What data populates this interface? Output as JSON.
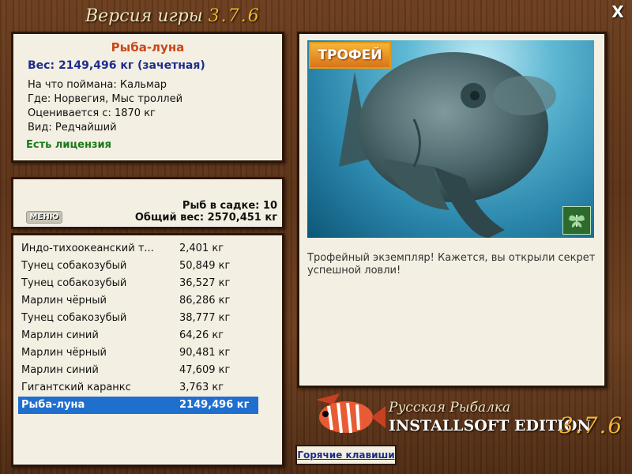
{
  "header": {
    "title": "Версия игры",
    "version": "3.7.6",
    "close_glyph": "X"
  },
  "info": {
    "fish_name": "Рыба-луна",
    "weight": "Вес: 2149,496 кг (зачетная)",
    "bait": "На что поймана: Кальмар",
    "location": "Где: Норвегия, Мыс троллей",
    "valued": "Оценивается с: 1870 кг",
    "rarity": "Вид: Редчайший",
    "license": "Есть лицензия"
  },
  "stats": {
    "menu_label": "МЕНЮ",
    "fish_count": "Рыб в садке: 10",
    "total_weight": "Общий вес: 2570,451 кг"
  },
  "catch_list": [
    {
      "name": "Индо-тихоокеанский т...",
      "weight": "2,401 кг"
    },
    {
      "name": "Тунец собакозубый",
      "weight": "50,849 кг"
    },
    {
      "name": "Тунец собакозубый",
      "weight": "36,527 кг"
    },
    {
      "name": "Марлин чёрный",
      "weight": "86,286 кг"
    },
    {
      "name": "Тунец собакозубый",
      "weight": "38,777 кг"
    },
    {
      "name": "Марлин синий",
      "weight": "64,26 кг"
    },
    {
      "name": "Марлин чёрный",
      "weight": "90,481 кг"
    },
    {
      "name": "Марлин синий",
      "weight": "47,609 кг"
    },
    {
      "name": "Гигантский каранкс",
      "weight": "3,763 кг"
    },
    {
      "name": "Рыба-луна",
      "weight": "2149,496 кг"
    }
  ],
  "selected_index": 9,
  "detail": {
    "badge": "ТРОФЕЙ",
    "description": "Трофейный экземпляр! Кажется, вы открыли секрет успешной ловли!",
    "icon": "butterfly-icon"
  },
  "logo": {
    "name": "Русская Рыбалка",
    "edition": "INSTALLSOFT EDITION",
    "version": "3.7.6"
  },
  "footer": {
    "hotkeys": "Горячие клавиши"
  },
  "colors": {
    "selection": "#1e6fce",
    "fish_name": "#c8481a",
    "weight": "#1e2d8c",
    "license": "#1a7a1a"
  }
}
